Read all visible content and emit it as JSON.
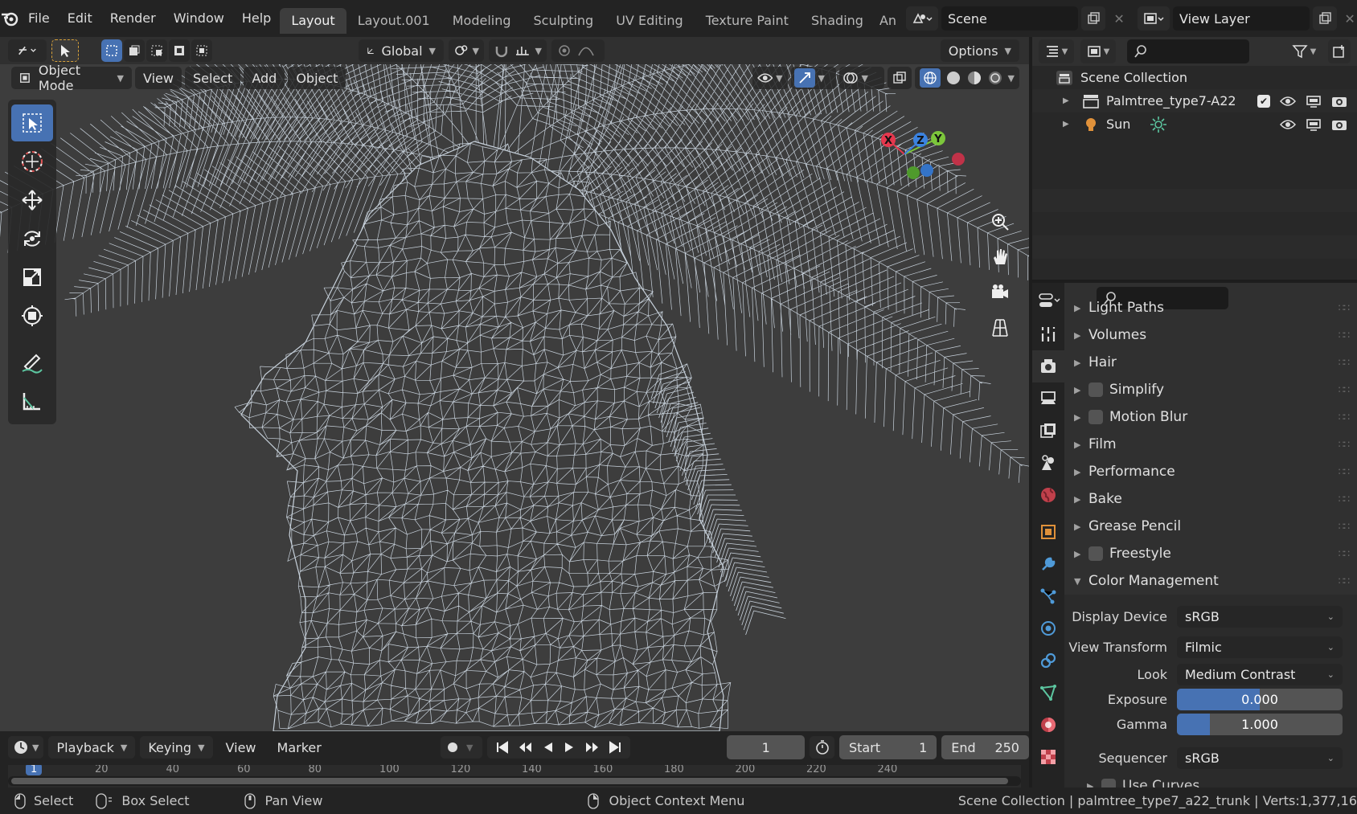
{
  "menu": [
    "File",
    "Edit",
    "Render",
    "Window",
    "Help"
  ],
  "workspaces": [
    "Layout",
    "Layout.001",
    "Modeling",
    "Sculpting",
    "UV Editing",
    "Texture Paint",
    "Shading",
    "An"
  ],
  "active_workspace": "Layout",
  "scene_name": "Scene",
  "view_layer_name": "View Layer",
  "viewport": {
    "orientation": "Global",
    "options_label": "Options",
    "mode": "Object Mode",
    "menus": [
      "View",
      "Select",
      "Add",
      "Object"
    ],
    "gizmo_axes": {
      "x": "X",
      "y": "Y",
      "z": "Z"
    }
  },
  "outliner": {
    "root": "Scene Collection",
    "items": [
      {
        "name": "Palmtree_type7-A22",
        "icon": "collection-icon"
      },
      {
        "name": "Sun",
        "icon": "light-icon"
      }
    ]
  },
  "properties": {
    "panels": [
      {
        "label": "Light Paths",
        "checkbox": false
      },
      {
        "label": "Volumes",
        "checkbox": false
      },
      {
        "label": "Hair",
        "checkbox": false
      },
      {
        "label": "Simplify",
        "checkbox": true
      },
      {
        "label": "Motion Blur",
        "checkbox": true
      },
      {
        "label": "Film",
        "checkbox": false
      },
      {
        "label": "Performance",
        "checkbox": false
      },
      {
        "label": "Bake",
        "checkbox": false
      },
      {
        "label": "Grease Pencil",
        "checkbox": false
      },
      {
        "label": "Freestyle",
        "checkbox": true
      },
      {
        "label": "Color Management",
        "checkbox": false,
        "expanded": true
      }
    ],
    "color_management": {
      "display_device_label": "Display Device",
      "display_device": "sRGB",
      "view_transform_label": "View Transform",
      "view_transform": "Filmic",
      "look_label": "Look",
      "look": "Medium Contrast",
      "exposure_label": "Exposure",
      "exposure": "0.000",
      "exposure_fill": 0.5,
      "gamma_label": "Gamma",
      "gamma": "1.000",
      "gamma_fill": 0.2,
      "sequencer_label": "Sequencer",
      "sequencer": "sRGB",
      "use_curves_label": "Use Curves"
    }
  },
  "timeline": {
    "menus": [
      "Playback",
      "Keying",
      "View",
      "Marker"
    ],
    "current_frame": "1",
    "start_label": "Start",
    "start": "1",
    "end_label": "End",
    "end": "250",
    "ruler_ticks": [
      "1",
      "20",
      "40",
      "60",
      "80",
      "100",
      "120",
      "140",
      "160",
      "180",
      "200",
      "220",
      "240"
    ]
  },
  "statusbar": {
    "select": "Select",
    "box_select": "Box Select",
    "pan_view": "Pan View",
    "context_menu": "Object Context Menu",
    "info": "Scene Collection | palmtree_type7_a22_trunk | Verts:1,377,16"
  },
  "colors": {
    "accent": "#4772b3",
    "wire": "#c8d2dc",
    "bg_viewport": "#3d3d3d"
  }
}
